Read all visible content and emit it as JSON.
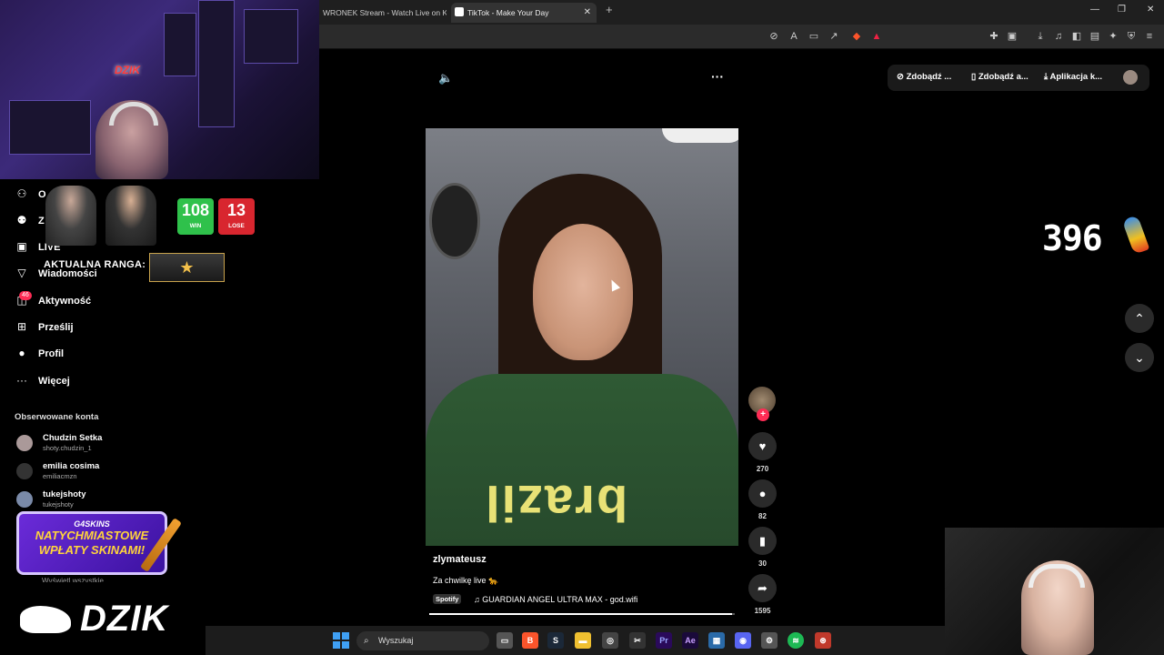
{
  "browser": {
    "tabs": [
      {
        "label": "WRONEK Stream - Watch Live on Kick",
        "active": false
      },
      {
        "label": "TikTok - Make Your Day",
        "active": true
      }
    ],
    "newtab_icon": "plus-icon",
    "window_controls": [
      "—",
      "❐",
      "✕"
    ]
  },
  "sidebar": {
    "items": [
      {
        "label": "O",
        "icon": "user-icon"
      },
      {
        "label": "Z",
        "icon": "users-icon"
      },
      {
        "label": "LIVE",
        "icon": "tv-icon"
      },
      {
        "label": "Wiadomości",
        "icon": "send-icon"
      },
      {
        "label": "Aktywność",
        "icon": "inbox-icon",
        "badge": "46"
      },
      {
        "label": "Prześlij",
        "icon": "plus-square-icon"
      },
      {
        "label": "Profil",
        "icon": "avatar-icon"
      },
      {
        "label": "Więcej",
        "icon": "more-icon"
      }
    ],
    "followed_title": "Obserwowane konta",
    "followed": [
      {
        "name": "Chudzin Setka",
        "handle": "shoty.chudzin_1"
      },
      {
        "name": "emilia cosima",
        "handle": "emiliacmzn"
      },
      {
        "name": "tukejshoty",
        "handle": "tukejshoty"
      }
    ],
    "see_all": "Wyświetl wszystkie"
  },
  "overlay": {
    "win_count": "108",
    "win_label": "WIN",
    "lose_count": "13",
    "lose_label": "LOSE",
    "rank_label": "AKTUALNA RANGA:",
    "promo_brand": "G4SKINS",
    "promo_line1": "NATYCHMIASTOWE",
    "promo_line2": "WPŁATY SKINAMI!",
    "footer_brand": "DZIK",
    "cam_brand": "DZIK",
    "counter": "396"
  },
  "tiktok": {
    "top_buttons": [
      {
        "label": "Zdobądź ...",
        "icon": "coin-icon"
      },
      {
        "label": "Zdobądź a...",
        "icon": "phone-icon"
      },
      {
        "label": "Aplikacja k...",
        "icon": "download-icon"
      }
    ],
    "author": "zlymateusz",
    "caption": "Za chwilkę live 🐆",
    "spotify_label": "Spotify",
    "music": "GUARDIAN ANGEL ULTRA MAX - god.wifi",
    "shirt_text": "brazil",
    "likes": "270",
    "comments": "82",
    "saves": "30",
    "shares": "1595",
    "progress": 0.99
  },
  "taskbar": {
    "search_placeholder": "Wyszukaj"
  }
}
